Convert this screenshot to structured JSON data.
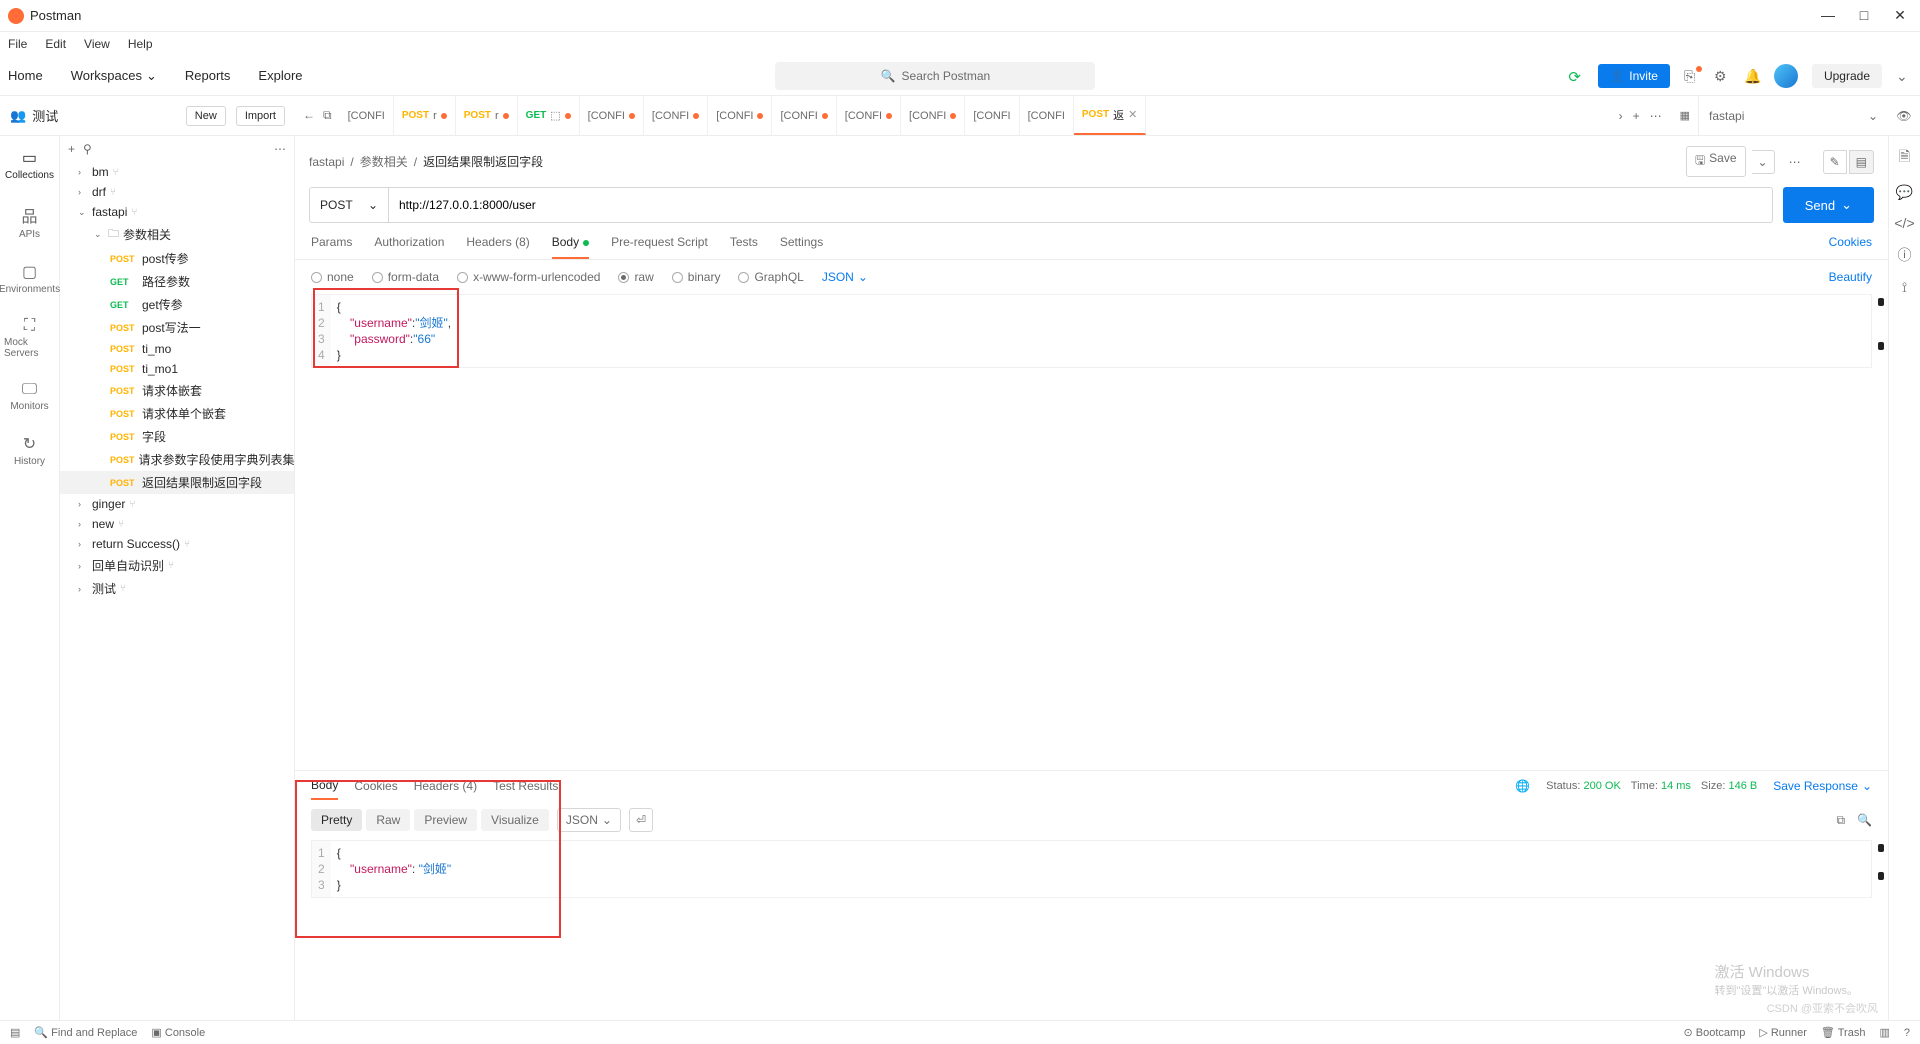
{
  "app": {
    "title": "Postman"
  },
  "menu": {
    "file": "File",
    "edit": "Edit",
    "view": "View",
    "help": "Help"
  },
  "nav": {
    "home": "Home",
    "workspaces": "Workspaces",
    "reports": "Reports",
    "explore": "Explore"
  },
  "search": {
    "placeholder": "Search Postman"
  },
  "actions": {
    "invite": "Invite",
    "upgrade": "Upgrade"
  },
  "workspace": {
    "name": "测试",
    "new": "New",
    "import": "Import"
  },
  "tabs": [
    {
      "method": "",
      "label": "[CONFI"
    },
    {
      "method": "POST",
      "label": "r",
      "dot": true
    },
    {
      "method": "POST",
      "label": "r",
      "dot": true
    },
    {
      "method": "GET",
      "label": "⬚",
      "dot": true
    },
    {
      "method": "",
      "label": "[CONFI",
      "dot": true
    },
    {
      "method": "",
      "label": "[CONFI",
      "dot": true
    },
    {
      "method": "",
      "label": "[CONFI",
      "dot": true
    },
    {
      "method": "",
      "label": "[CONFI",
      "dot": true
    },
    {
      "method": "",
      "label": "[CONFI",
      "dot": true
    },
    {
      "method": "",
      "label": "[CONFI",
      "dot": true
    },
    {
      "method": "",
      "label": "[CONFI"
    },
    {
      "method": "",
      "label": "[CONFI"
    },
    {
      "method": "POST",
      "label": "返",
      "active": true,
      "close": true
    }
  ],
  "env": {
    "selected": "fastapi"
  },
  "rail": {
    "collections": "Collections",
    "apis": "APIs",
    "environments": "Environments",
    "mock": "Mock Servers",
    "monitors": "Monitors",
    "history": "History"
  },
  "tree": {
    "bm": "bm",
    "drf": "drf",
    "fastapi": "fastapi",
    "folder": "参数相关",
    "r1": "post传参",
    "r2": "路径参数",
    "r3": "get传参",
    "r4": "post写法一",
    "r5": "ti_mo",
    "r6": "ti_mo1",
    "r7": "请求体嵌套",
    "r8": "请求体单个嵌套",
    "r9": "字段",
    "r10": "请求参数字段使用字典列表集合...",
    "r11": "返回结果限制返回字段",
    "ginger": "ginger",
    "new": "new",
    "returnSuccess": "return Success()",
    "autoRec": "回单自动识别",
    "test": "测试"
  },
  "breadcrumb": {
    "col": "fastapi",
    "folder": "参数相关",
    "req": "返回结果限制返回字段",
    "save": "Save"
  },
  "request": {
    "method": "POST",
    "url": "http://127.0.0.1:8000/user",
    "send": "Send",
    "tabs": {
      "params": "Params",
      "auth": "Authorization",
      "headers": "Headers (8)",
      "body": "Body",
      "prereq": "Pre-request Script",
      "tests": "Tests",
      "settings": "Settings",
      "cookies": "Cookies"
    },
    "bodyTypes": {
      "none": "none",
      "formdata": "form-data",
      "urlencoded": "x-www-form-urlencoded",
      "raw": "raw",
      "binary": "binary",
      "graphql": "GraphQL",
      "lang": "JSON",
      "beautify": "Beautify"
    },
    "body": {
      "k1": "\"username\"",
      "v1": "\"剑姬\"",
      "k2": "\"password\"",
      "v2": "\"66\""
    }
  },
  "response": {
    "tabs": {
      "body": "Body",
      "cookies": "Cookies",
      "headers": "Headers (4)",
      "test": "Test Results"
    },
    "sub": {
      "pretty": "Pretty",
      "raw": "Raw",
      "preview": "Preview",
      "visualize": "Visualize",
      "fmt": "JSON"
    },
    "meta": {
      "statusLabel": "Status:",
      "status": "200 OK",
      "timeLabel": "Time:",
      "time": "14 ms",
      "sizeLabel": "Size:",
      "size": "146 B",
      "save": "Save Response"
    },
    "body": {
      "k1": "\"username\"",
      "v1": "\"剑姬\""
    }
  },
  "status": {
    "find": "Find and Replace",
    "console": "Console",
    "bootcamp": "Bootcamp",
    "runner": "Runner",
    "trash": "Trash"
  },
  "watermark": {
    "line1": "激活 Windows",
    "line2": "转到\"设置\"以激活 Windows。",
    "csdn": "CSDN @亚索不会吹风"
  }
}
